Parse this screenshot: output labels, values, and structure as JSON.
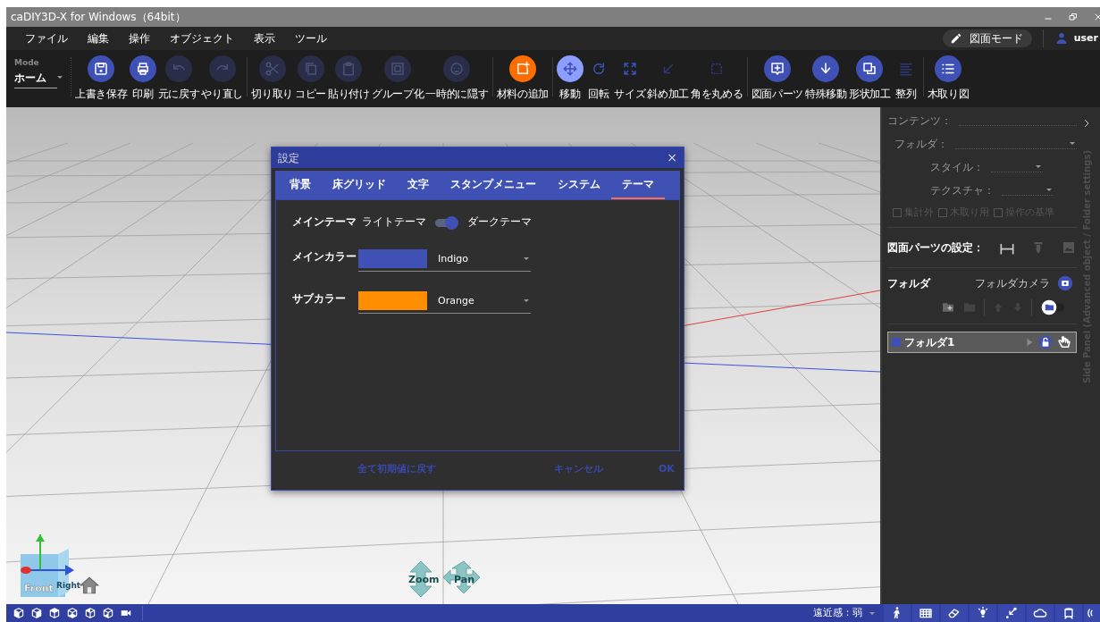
{
  "window": {
    "title": "caDIY3D-X for Windows（64bit）"
  },
  "menu": [
    "ファイル",
    "編集",
    "操作",
    "オブジェクト",
    "表示",
    "ツール"
  ],
  "drawing_mode_button": "図面モード",
  "user": "user",
  "mode": {
    "label": "Mode",
    "value": "ホーム"
  },
  "toolbar": [
    [
      {
        "label": "上書き保存",
        "kind": "primary",
        "disabled": false
      },
      {
        "label": "印刷",
        "kind": "primary",
        "disabled": false
      },
      {
        "label": "元に戻す",
        "kind": "primary",
        "disabled": true
      },
      {
        "label": "やり直し",
        "kind": "primary",
        "disabled": true
      }
    ],
    [
      {
        "label": "切り取り",
        "kind": "primary",
        "disabled": true
      },
      {
        "label": "コピー",
        "kind": "primary",
        "disabled": true
      },
      {
        "label": "貼り付け",
        "kind": "primary",
        "disabled": true
      },
      {
        "label": "グループ化",
        "kind": "primary",
        "disabled": true
      },
      {
        "label": "一時的に隠す",
        "kind": "primary",
        "disabled": true
      }
    ],
    [
      {
        "label": "材料の追加",
        "kind": "accent",
        "disabled": false
      }
    ],
    [
      {
        "label": "移動",
        "kind": "active",
        "disabled": false
      },
      {
        "label": "回転",
        "kind": "plain",
        "disabled": false
      },
      {
        "label": "サイズ",
        "kind": "plain",
        "disabled": false
      },
      {
        "label": "斜め加工",
        "kind": "plain",
        "disabled": true
      },
      {
        "label": "角を丸める",
        "kind": "plain",
        "disabled": true
      }
    ],
    [
      {
        "label": "図面パーツ",
        "kind": "primary",
        "disabled": false
      },
      {
        "label": "特殊移動",
        "kind": "primary",
        "disabled": false
      },
      {
        "label": "形状加工",
        "kind": "primary",
        "disabled": false
      },
      {
        "label": "整列",
        "kind": "plain",
        "disabled": true
      }
    ],
    [
      {
        "label": "木取り図",
        "kind": "primary",
        "disabled": false
      }
    ]
  ],
  "viewport": {
    "view_cube": {
      "front": "Front",
      "right": "Right"
    },
    "zoom": "Zoom",
    "pan": "Pan"
  },
  "settings_dialog": {
    "title": "設定",
    "close": "×",
    "tabs": [
      {
        "label": "背景",
        "selected": false
      },
      {
        "label": "床グリッド",
        "selected": false
      },
      {
        "label": "文字",
        "selected": false
      },
      {
        "label": "スタンプメニュー",
        "selected": false
      },
      {
        "label": "システム",
        "selected": false
      },
      {
        "label": "テーマ",
        "selected": true
      }
    ],
    "theme": {
      "label": "メインテーマ",
      "light": "ライトテーマ",
      "dark": "ダークテーマ",
      "dark_on": true
    },
    "colors": [
      {
        "label": "メインカラー",
        "name": "Indigo",
        "color": "#3f51b5"
      },
      {
        "label": "サブカラー",
        "name": "Orange",
        "color": "#ff8f00"
      }
    ],
    "buttons": [
      "全て初期値に戻す",
      "キャンセル",
      "OK"
    ]
  },
  "side_panel": {
    "title": "Side Panel (Advanced object / Folder settings)",
    "fields": [
      {
        "label": "コンテンツ：",
        "kind": "text"
      },
      {
        "label": "フォルダ：",
        "kind": "select"
      },
      {
        "label": "スタイル：",
        "kind": "select"
      },
      {
        "label": "テクスチャ：",
        "kind": "select"
      }
    ],
    "options": [
      {
        "label": "集計外",
        "checked": false,
        "disabled": true
      },
      {
        "label": "木取り用",
        "checked": false,
        "disabled": true
      },
      {
        "label": "操作の基準",
        "checked": false,
        "disabled": true
      }
    ],
    "drawing_parts_label": "図面パーツの設定：",
    "folder_title": "フォルダ",
    "camera_label": "フォルダカメラ",
    "folders": [
      {
        "name": "フォルダ1",
        "checked": true,
        "selected": true
      }
    ]
  },
  "status_bar": {
    "perspective": "遠近感：弱"
  }
}
